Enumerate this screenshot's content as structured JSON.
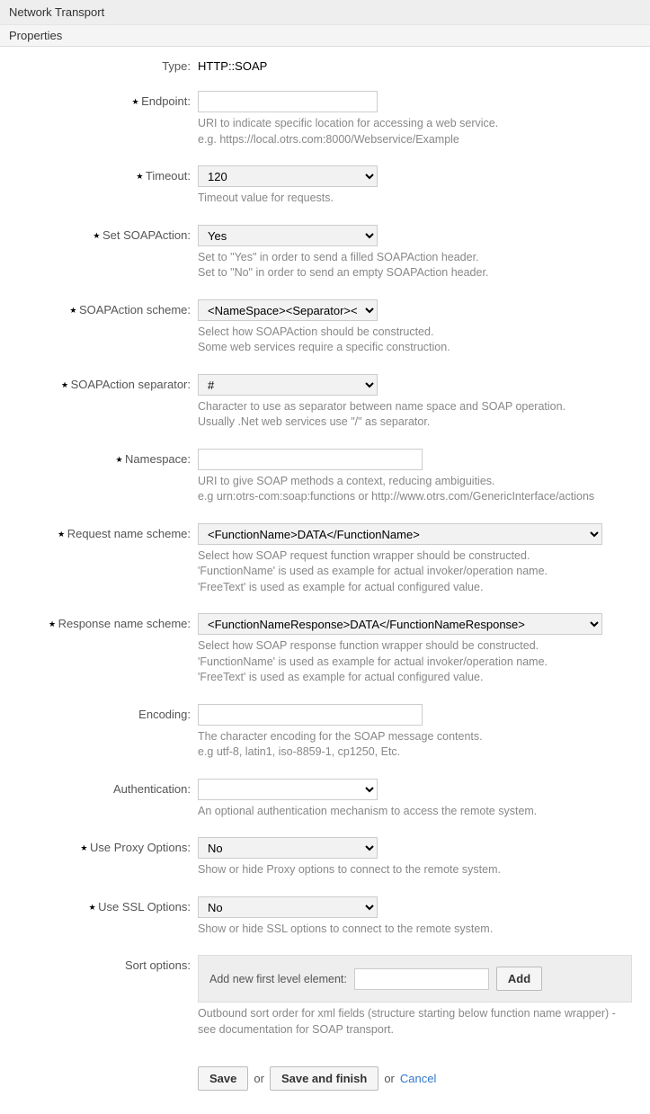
{
  "panel": {
    "title": "Network Transport"
  },
  "section": {
    "title": "Properties"
  },
  "fields": {
    "type": {
      "label": "Type:",
      "value": "HTTP::SOAP"
    },
    "endpoint": {
      "label": "Endpoint:",
      "value": "",
      "help1": "URI to indicate specific location for accessing a web service.",
      "help2": "e.g. https://local.otrs.com:8000/Webservice/Example"
    },
    "timeout": {
      "label": "Timeout:",
      "value": "120",
      "help1": "Timeout value for requests."
    },
    "setSoapAction": {
      "label": "Set SOAPAction:",
      "value": "Yes",
      "help1": "Set to \"Yes\" in order to send a filled SOAPAction header.",
      "help2": "Set to \"No\" in order to send an empty SOAPAction header."
    },
    "soapActionScheme": {
      "label": "SOAPAction scheme:",
      "value": "<NameSpace><Separator><Operation>",
      "help1": "Select how SOAPAction should be constructed.",
      "help2": "Some web services require a specific construction."
    },
    "soapActionSeparator": {
      "label": "SOAPAction separator:",
      "value": "#",
      "help1": "Character to use as separator between name space and SOAP operation.",
      "help2": "Usually .Net web services use \"/\" as separator."
    },
    "namespace": {
      "label": "Namespace:",
      "value": "",
      "help1": "URI to give SOAP methods a context, reducing ambiguities.",
      "help2": "e.g urn:otrs-com:soap:functions or http://www.otrs.com/GenericInterface/actions"
    },
    "requestNameScheme": {
      "label": "Request name scheme:",
      "value": "<FunctionName>DATA</FunctionName>",
      "help1": "Select how SOAP request function wrapper should be constructed.",
      "help2": "'FunctionName' is used as example for actual invoker/operation name.",
      "help3": "'FreeText' is used as example for actual configured value."
    },
    "responseNameScheme": {
      "label": "Response name scheme:",
      "value": "<FunctionNameResponse>DATA</FunctionNameResponse>",
      "help1": "Select how SOAP response function wrapper should be constructed.",
      "help2": "'FunctionName' is used as example for actual invoker/operation name.",
      "help3": "'FreeText' is used as example for actual configured value."
    },
    "encoding": {
      "label": "Encoding:",
      "value": "",
      "help1": "The character encoding for the SOAP message contents.",
      "help2": "e.g utf-8, latin1, iso-8859-1, cp1250, Etc."
    },
    "authentication": {
      "label": "Authentication:",
      "value": "",
      "help1": "An optional authentication mechanism to access the remote system."
    },
    "useProxy": {
      "label": "Use Proxy Options:",
      "value": "No",
      "help1": "Show or hide Proxy options to connect to the remote system."
    },
    "useSSL": {
      "label": "Use SSL Options:",
      "value": "No",
      "help1": "Show or hide SSL options to connect to the remote system."
    },
    "sortOptions": {
      "label": "Sort options:",
      "addLabel": "Add new first level element:",
      "addButton": "Add",
      "value": "",
      "help1": "Outbound sort order for xml fields (structure starting below function name wrapper) - see documentation for SOAP transport."
    }
  },
  "actions": {
    "save": "Save",
    "or1": "or",
    "saveFinish": "Save and finish",
    "or2": "or",
    "cancel": "Cancel"
  }
}
